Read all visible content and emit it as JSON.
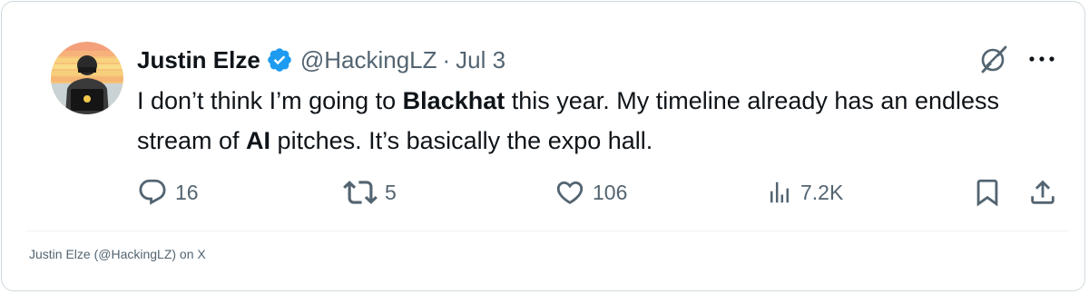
{
  "tweet": {
    "author_name": "Justin Elze",
    "handle": "@HackingLZ",
    "separator": "·",
    "date": "Jul 3",
    "text_part1": "I don’t think I’m going to ",
    "text_bold1": "Blackhat",
    "text_part2": " this year. My timeline already has an endless stream of ",
    "text_bold2": "AI",
    "text_part3": " pitches. It’s basically the expo hall.",
    "verified": true
  },
  "actions": {
    "replies": "16",
    "reposts": "5",
    "likes": "106",
    "views": "7.2K"
  },
  "footer": {
    "attribution": "Justin Elze (@HackingLZ) on X"
  },
  "colors": {
    "text": "#0f1419",
    "muted": "#536471",
    "verified_blue": "#1d9bf0",
    "border": "#cfd9de"
  },
  "icons": {
    "verified": "verified-badge-icon",
    "grok": "grok-icon",
    "more": "more-icon",
    "reply": "reply-icon",
    "repost": "repost-icon",
    "like": "heart-icon",
    "views": "views-bar-chart-icon",
    "bookmark": "bookmark-icon",
    "share": "share-icon"
  }
}
